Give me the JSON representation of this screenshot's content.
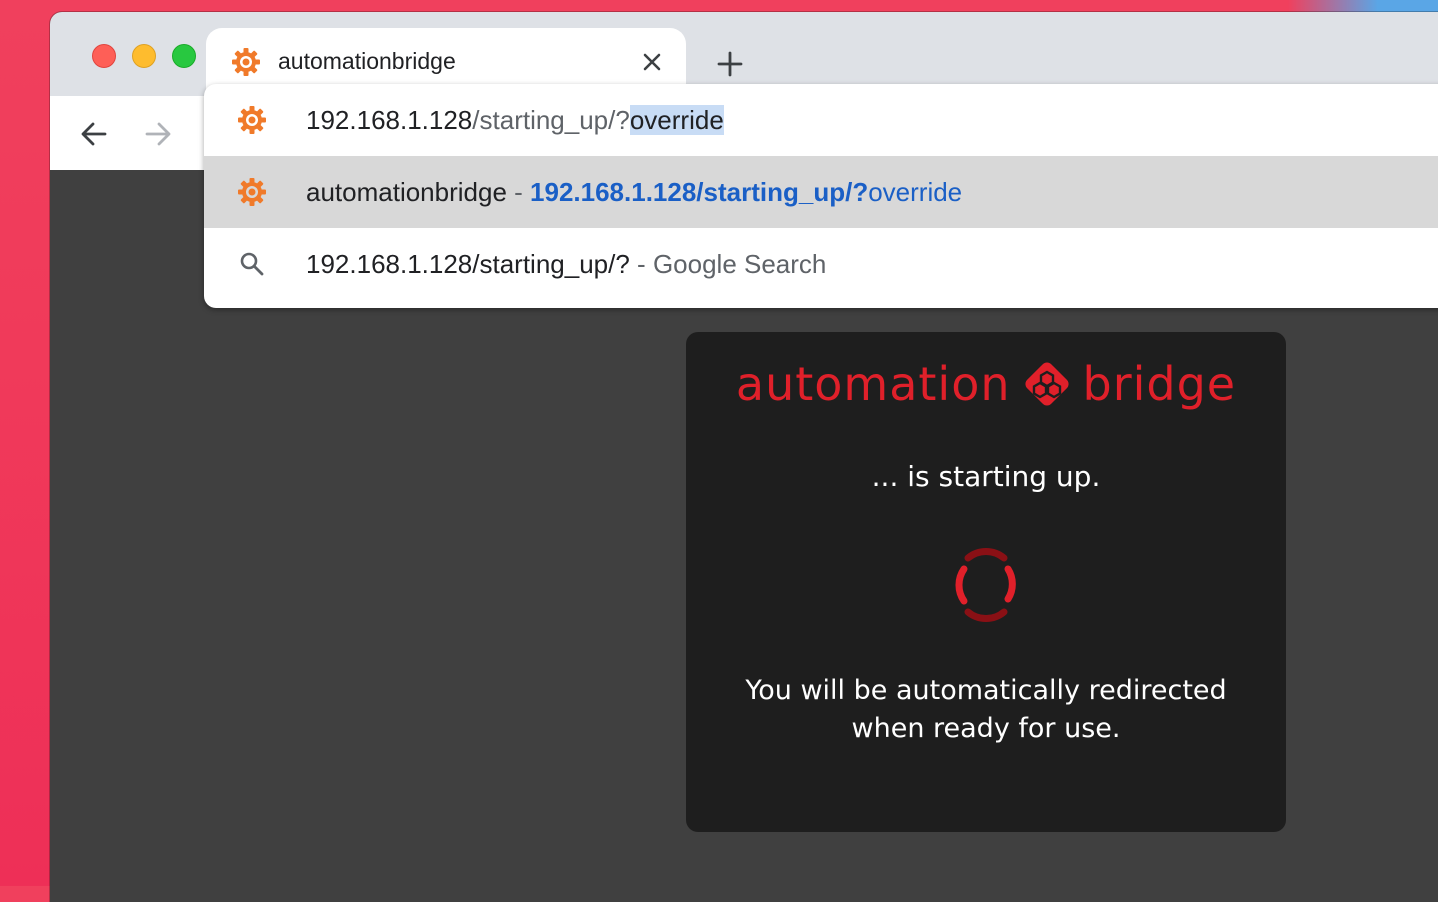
{
  "browser": {
    "tab": {
      "title": "automationbridge",
      "favicon": "automationbridge-gear-icon"
    },
    "new_tab_icon": "plus-icon",
    "nav": {
      "back_icon": "arrow-left-icon",
      "forward_icon": "arrow-right-icon",
      "reload_icon": "reload-icon"
    }
  },
  "omnibox": {
    "input": {
      "host": "192.168.1.128",
      "path": "/starting_up/?",
      "selected": "override"
    },
    "suggestions": [
      {
        "icon": "automationbridge-gear-icon",
        "title": "automationbridge",
        "separator": " - ",
        "url_bold": "192.168.1.128/starting_up/?",
        "url_rest": "override"
      },
      {
        "icon": "search-icon",
        "query": "192.168.1.128/starting_up/?",
        "separator": " - ",
        "source": "Google Search"
      }
    ]
  },
  "page": {
    "logo": {
      "left": "automation",
      "right": "bridge",
      "accent": "#e0202a"
    },
    "starting_message": "... is starting up.",
    "redirect_message": "You will be automatically redirected when ready for use."
  },
  "colors": {
    "card_bg": "#1e1e1e",
    "page_bg": "#404040",
    "link_blue": "#1a5fc6",
    "selection": "#c8dcf5"
  }
}
